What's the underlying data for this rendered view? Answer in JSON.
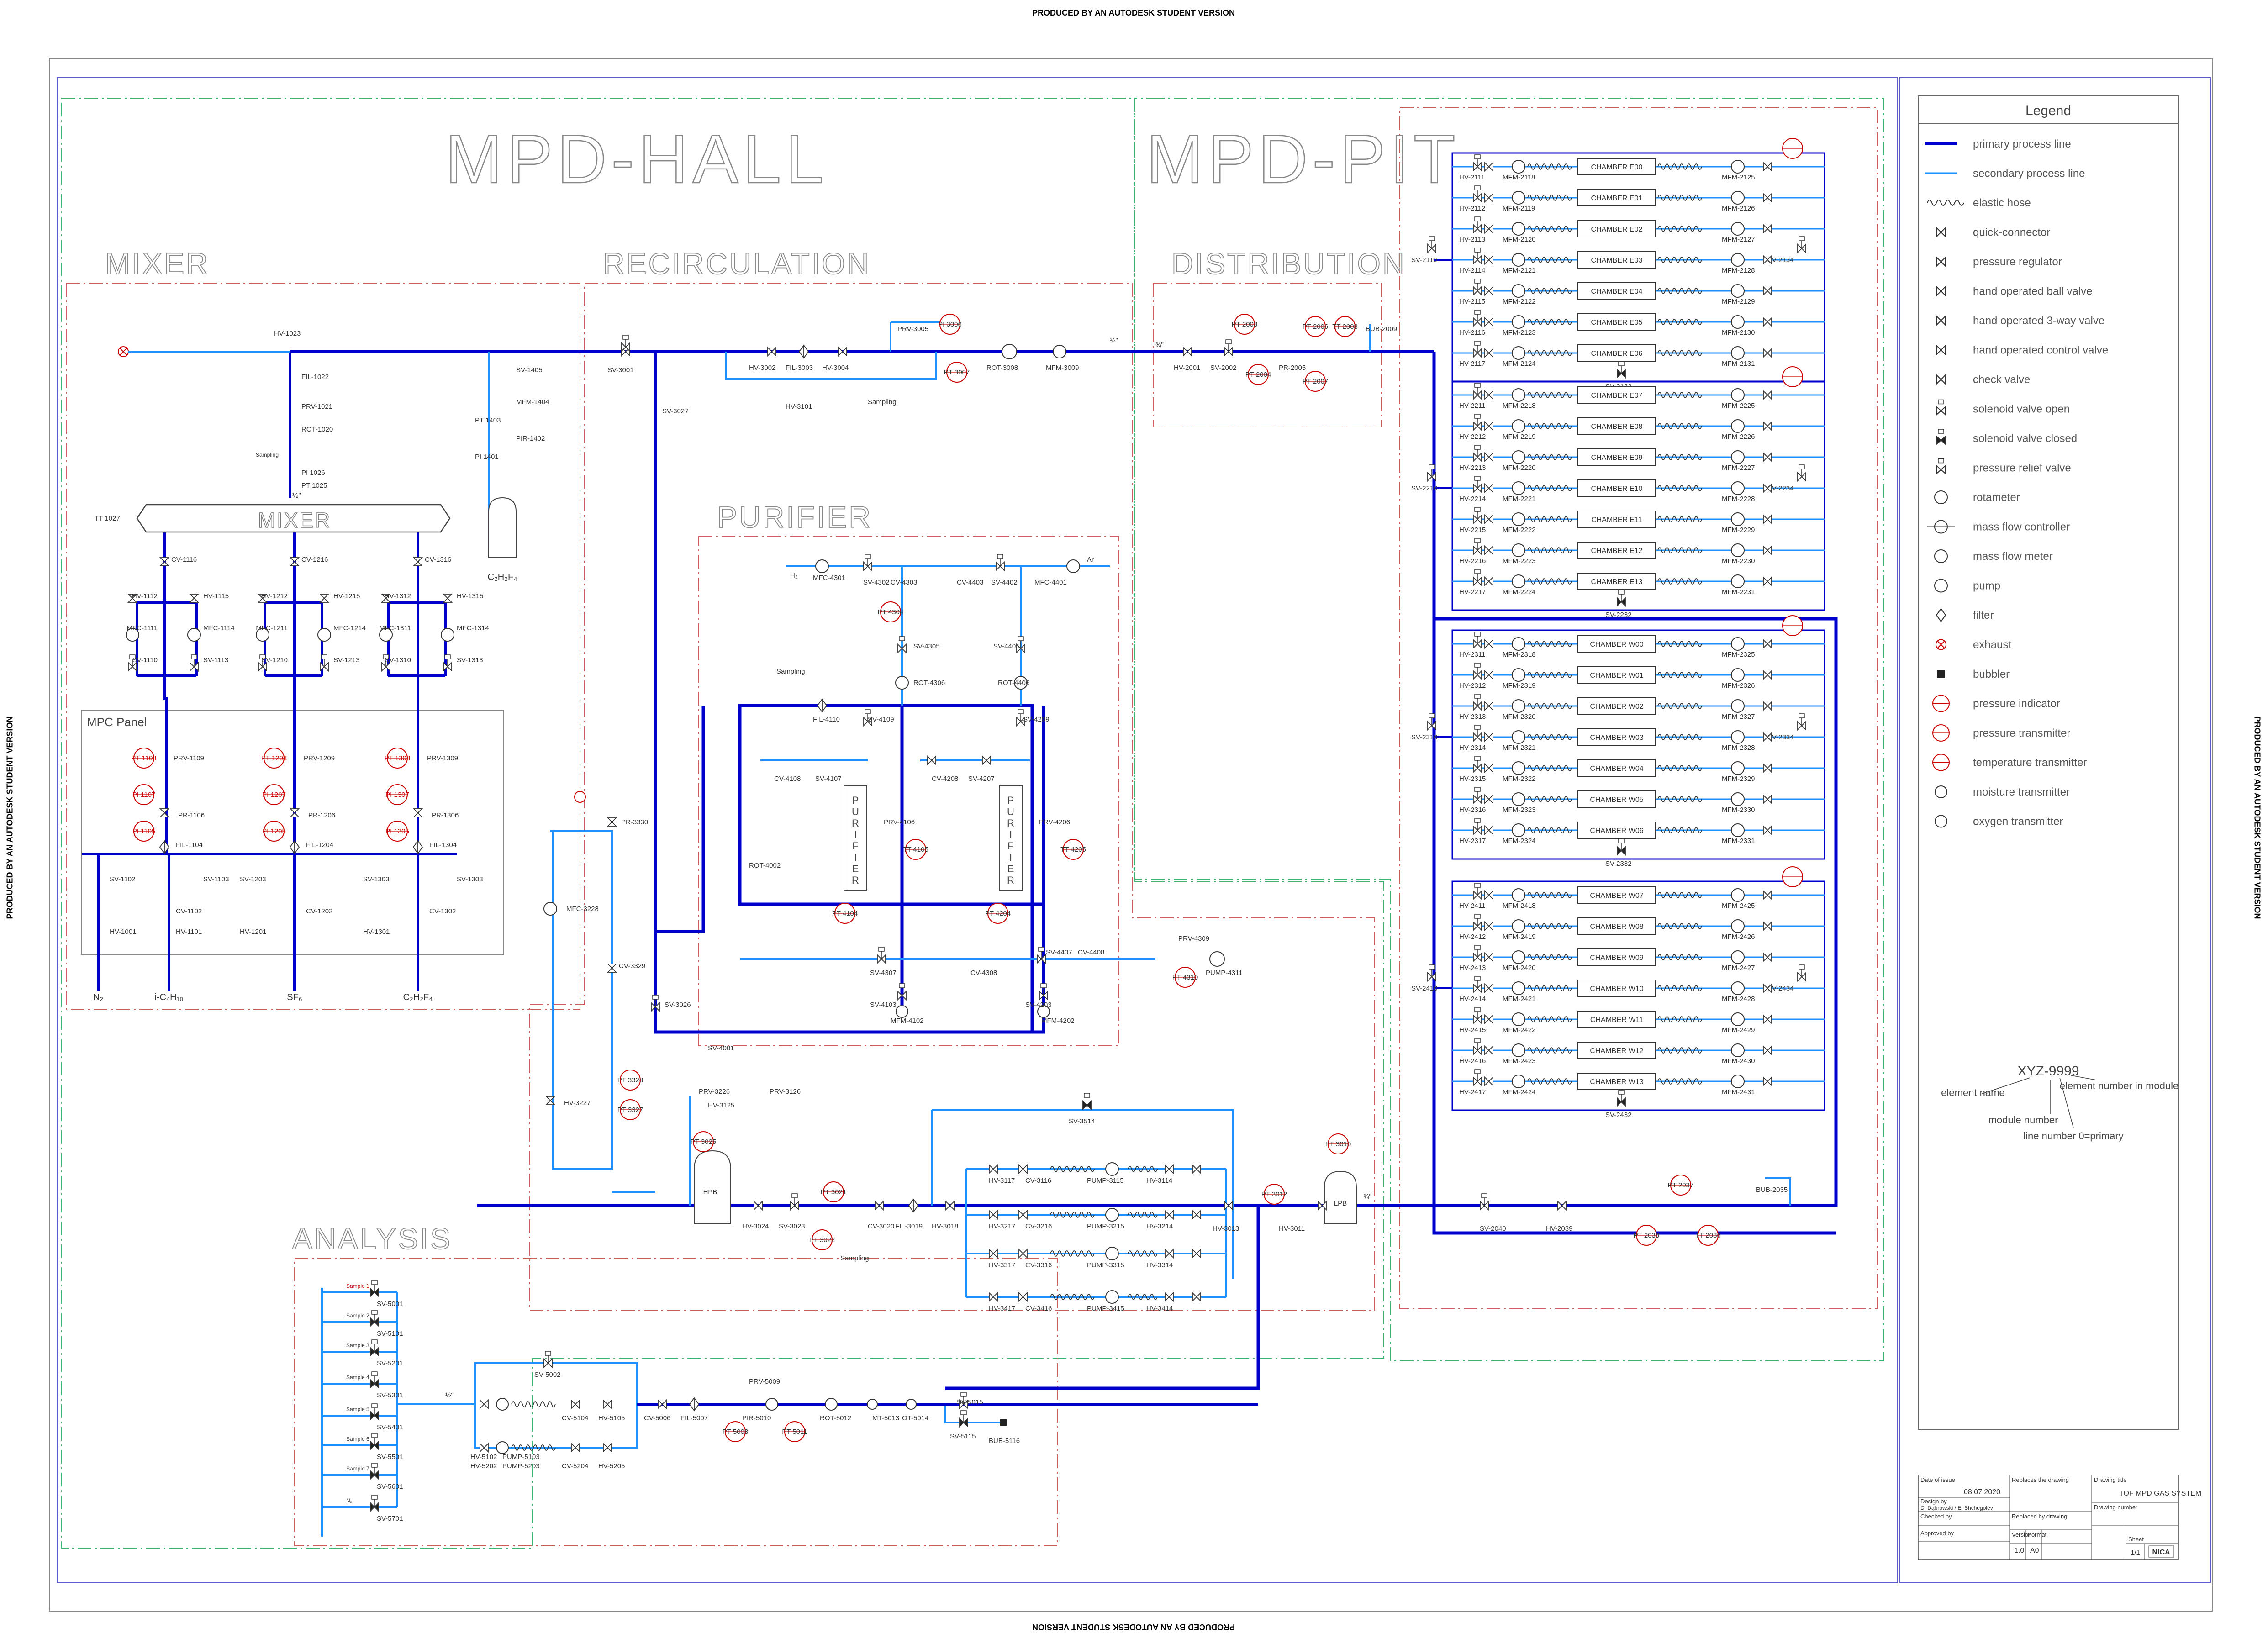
{
  "banner": "PRODUCED BY AN AUTODESK STUDENT VERSION",
  "areas": {
    "hall": "MPD-HALL",
    "pit": "MPD-PIT"
  },
  "sections": {
    "mixer": "MIXER",
    "recirculation": "RECIRCULATION",
    "distribution": "DISTRIBUTION",
    "purifier": "PURIFIER",
    "analysis": "ANALYSIS",
    "mpc_panel": "MPC Panel"
  },
  "mixer": {
    "vessel_label": "MIXER",
    "top_labels": [
      "HV-1023",
      "FIL-1022",
      "PRV-1021",
      "ROT-1020",
      "PI 1026",
      "PT 1025",
      "TT 1027",
      "SV-1405",
      "MFM-1404",
      "PIR-1402",
      "PT 1403",
      "PI 1401"
    ],
    "channels": [
      {
        "cv": "CV-1116",
        "hv_a": "HV-1112",
        "hv_b": "HV-1115",
        "mfc_a": "MFC-1111",
        "mfc_b": "MFC-1114",
        "sv_a": "SV-1110",
        "sv_b": "SV-1113",
        "prv": "PRV-1109",
        "pt": "PT 1108",
        "pi": "PI 1107",
        "pr": "PR-1106",
        "pi2": "PI 1105",
        "fil": "FIL-1104",
        "sv_low_a": "SV-1102",
        "sv_low_b": "SV-1103",
        "cv_low": "CV-1102",
        "hv_low_a": "HV-1001",
        "hv_low_b": "HV-1101"
      },
      {
        "cv": "CV-1216",
        "hv_a": "HV-1212",
        "hv_b": "HV-1215",
        "mfc_a": "MFC-1211",
        "mfc_b": "MFC-1214",
        "sv_a": "SV-1210",
        "sv_b": "SV-1213",
        "prv": "PRV-1209",
        "pt": "PT 1208",
        "pi": "PI 1207",
        "pr": "PR-1206",
        "pi2": "PI 1205",
        "fil": "FIL-1204",
        "sv_low_a": "SV-1203",
        "sv_low_b": "",
        "cv_low": "CV-1202",
        "hv_low_a": "HV-1201",
        "hv_low_b": ""
      },
      {
        "cv": "CV-1316",
        "hv_a": "HV-1312",
        "hv_b": "HV-1315",
        "mfc_a": "MFC-1311",
        "mfc_b": "MFC-1314",
        "sv_a": "SV-1310",
        "sv_b": "SV-1313",
        "prv": "PRV-1309",
        "pt": "PT 1308",
        "pi": "PI 1307",
        "pr": "PR-1306",
        "pi2": "PI 1305",
        "fil": "FIL-1304",
        "sv_low_a": "SV-1303",
        "sv_low_b": "SV-1303",
        "cv_low": "CV-1302",
        "hv_low_a": "HV-1301",
        "hv_low_b": ""
      }
    ],
    "sampling": "Sampling",
    "quarter": "¼\"",
    "half": "½\"",
    "gases": [
      "N₂",
      "i-C₄H₁₀",
      "SF₆",
      "C₂H₂F₄"
    ],
    "bottle": "C₂H₂F₄"
  },
  "recirculation": {
    "labels": [
      "SV-3001",
      "SV-3027",
      "HV-3002",
      "FIL-3003",
      "HV-3004",
      "HV-3101",
      "PRV-3005",
      "PI 3006",
      "PT 3007",
      "ROT-3008",
      "MFM-3009",
      "Sampling",
      "¾\""
    ]
  },
  "distribution_labels": [
    "HV-2001",
    "SV-2002",
    "PT 2003",
    "PT 2004",
    "PR-2005",
    "PT 2006",
    "TT 2008",
    "PT 2007",
    "BUB-2009",
    "¾\""
  ],
  "chamber_groups": [
    {
      "rows": [
        {
          "chamber": "CHAMBER E00",
          "hv": "HV-2111",
          "mfm_in": "MFM-2118",
          "mfm_out": "MFM-2125"
        },
        {
          "chamber": "CHAMBER E01",
          "hv": "HV-2112",
          "mfm_in": "MFM-2119",
          "mfm_out": "MFM-2126"
        },
        {
          "chamber": "CHAMBER E02",
          "hv": "HV-2113",
          "mfm_in": "MFM-2120",
          "mfm_out": "MFM-2127"
        },
        {
          "chamber": "CHAMBER E03",
          "hv": "HV-2114",
          "mfm_in": "MFM-2121",
          "mfm_out": "MFM-2128"
        },
        {
          "chamber": "CHAMBER E04",
          "hv": "HV-2115",
          "mfm_in": "MFM-2122",
          "mfm_out": "MFM-2129"
        },
        {
          "chamber": "CHAMBER E05",
          "hv": "HV-2116",
          "mfm_in": "MFM-2123",
          "mfm_out": "MFM-2130"
        },
        {
          "chamber": "CHAMBER E06",
          "hv": "HV-2117",
          "mfm_in": "MFM-2124",
          "mfm_out": "MFM-2131"
        }
      ],
      "sv_in": "SV-2110",
      "sv_out": "SV-2134",
      "sv_bottom": "SV-2132",
      "pt": "PT 2133"
    },
    {
      "rows": [
        {
          "chamber": "CHAMBER E07",
          "hv": "HV-2211",
          "mfm_in": "MFM-2218",
          "mfm_out": "MFM-2225"
        },
        {
          "chamber": "CHAMBER E08",
          "hv": "HV-2212",
          "mfm_in": "MFM-2219",
          "mfm_out": "MFM-2226"
        },
        {
          "chamber": "CHAMBER E09",
          "hv": "HV-2213",
          "mfm_in": "MFM-2220",
          "mfm_out": "MFM-2227"
        },
        {
          "chamber": "CHAMBER E10",
          "hv": "HV-2214",
          "mfm_in": "MFM-2221",
          "mfm_out": "MFM-2228"
        },
        {
          "chamber": "CHAMBER E11",
          "hv": "HV-2215",
          "mfm_in": "MFM-2222",
          "mfm_out": "MFM-2229"
        },
        {
          "chamber": "CHAMBER E12",
          "hv": "HV-2216",
          "mfm_in": "MFM-2223",
          "mfm_out": "MFM-2230"
        },
        {
          "chamber": "CHAMBER E13",
          "hv": "HV-2217",
          "mfm_in": "MFM-2224",
          "mfm_out": "MFM-2231"
        }
      ],
      "sv_in": "SV-2210",
      "sv_out": "SV-2234",
      "sv_bottom": "SV-2232",
      "pt": "PT 2233"
    },
    {
      "rows": [
        {
          "chamber": "CHAMBER W00",
          "hv": "HV-2311",
          "mfm_in": "MFM-2318",
          "mfm_out": "MFM-2325"
        },
        {
          "chamber": "CHAMBER W01",
          "hv": "HV-2312",
          "mfm_in": "MFM-2319",
          "mfm_out": "MFM-2326"
        },
        {
          "chamber": "CHAMBER W02",
          "hv": "HV-2313",
          "mfm_in": "MFM-2320",
          "mfm_out": "MFM-2327"
        },
        {
          "chamber": "CHAMBER W03",
          "hv": "HV-2314",
          "mfm_in": "MFM-2321",
          "mfm_out": "MFM-2328"
        },
        {
          "chamber": "CHAMBER W04",
          "hv": "HV-2315",
          "mfm_in": "MFM-2322",
          "mfm_out": "MFM-2329"
        },
        {
          "chamber": "CHAMBER W05",
          "hv": "HV-2316",
          "mfm_in": "MFM-2323",
          "mfm_out": "MFM-2330"
        },
        {
          "chamber": "CHAMBER W06",
          "hv": "HV-2317",
          "mfm_in": "MFM-2324",
          "mfm_out": "MFM-2331"
        }
      ],
      "sv_in": "SV-2310",
      "sv_out": "SV-2334",
      "sv_bottom": "SV-2332",
      "pt": "PT 2333"
    },
    {
      "rows": [
        {
          "chamber": "CHAMBER W07",
          "hv": "HV-2411",
          "mfm_in": "MFM-2418",
          "mfm_out": "MFM-2425"
        },
        {
          "chamber": "CHAMBER W08",
          "hv": "HV-2412",
          "mfm_in": "MFM-2419",
          "mfm_out": "MFM-2426"
        },
        {
          "chamber": "CHAMBER W09",
          "hv": "HV-2413",
          "mfm_in": "MFM-2420",
          "mfm_out": "MFM-2427"
        },
        {
          "chamber": "CHAMBER W10",
          "hv": "HV-2414",
          "mfm_in": "MFM-2421",
          "mfm_out": "MFM-2428"
        },
        {
          "chamber": "CHAMBER W11",
          "hv": "HV-2415",
          "mfm_in": "MFM-2422",
          "mfm_out": "MFM-2429"
        },
        {
          "chamber": "CHAMBER W12",
          "hv": "HV-2416",
          "mfm_in": "MFM-2423",
          "mfm_out": "MFM-2430"
        },
        {
          "chamber": "CHAMBER W13",
          "hv": "HV-2417",
          "mfm_in": "MFM-2424",
          "mfm_out": "MFM-2431"
        }
      ],
      "sv_in": "SV-2410",
      "sv_out": "SV-2434",
      "sv_bottom": "SV-2432",
      "pt": "PT 2433"
    }
  ],
  "purifier": {
    "top_labels": [
      "H₂",
      "MFC-4301",
      "SV-4302",
      "CV-4303",
      "CV-4403",
      "SV-4402",
      "MFC-4401",
      "Ar",
      "SV-4305",
      "SV-4405",
      "PT 4304",
      "ROT-4306",
      "ROT-4406",
      "Sampling",
      "FIL-4110",
      "SV-4109",
      "SV-4209",
      "CV-4108",
      "SV-4107",
      "CV-4208",
      "SV-4207",
      "PRV-4106",
      "PRV-4206",
      "TT 4105",
      "TT 4205",
      "ROT-4002",
      "PT 4104",
      "PT 4204",
      "SV-4307",
      "CV-4308",
      "SV-4407",
      "CV-4408",
      "PRV-4309",
      "PT 4310",
      "PUMP-4311",
      "SV-4103",
      "SV-4203",
      "MFM-4102",
      "MFM-4202",
      "SV-4001"
    ],
    "unit_letters": "PURIFIER"
  },
  "recycle_labels": [
    "PR-3330",
    "MFC-3228",
    "CV-3329",
    "HV-3227",
    "PT 3328",
    "PT 3327",
    "SV-3026"
  ],
  "pump_labels": [
    "PRV-3226",
    "PRV-3126",
    "HV-3125",
    "PT 3025",
    "HPB",
    "HV-3024",
    "SV-3023",
    "PT 3021",
    "PT 3022",
    "CV-3020",
    "FIL-3019",
    "HV-3018",
    "Sampling",
    "SV-3514",
    "HV-3117",
    "CV-3116",
    "PUMP-3115",
    "HV-3114",
    "HV-3217",
    "CV-3216",
    "PUMP-3215",
    "HV-3214",
    "HV-3317",
    "CV-3316",
    "PUMP-3315",
    "HV-3314",
    "HV-3417",
    "CV-3416",
    "PUMP-3415",
    "HV-3414",
    "HV-3013",
    "PT 3012",
    "HV-3011",
    "PT 3010",
    "LPB",
    "SV-2040",
    "HV-2039",
    "PT 2038",
    "PT 2037",
    "TT 2036",
    "BUB-2035",
    "¾\""
  ],
  "analysis": {
    "samples": [
      {
        "name": "Sample 1",
        "sv": "SV-5001"
      },
      {
        "name": "Sample 2",
        "sv": "SV-5101"
      },
      {
        "name": "Sample 3",
        "sv": "SV-5201"
      },
      {
        "name": "Sample 4",
        "sv": "SV-5301"
      },
      {
        "name": "Sample 5",
        "sv": "SV-5401"
      },
      {
        "name": "Sample 6",
        "sv": "SV-5501"
      },
      {
        "name": "Sample 7",
        "sv": "SV-5601"
      },
      {
        "name": "N₂",
        "sv": "SV-5701"
      }
    ],
    "labels": [
      "SV-5002",
      "HV-5102",
      "PUMP-5103",
      "CV-5104",
      "HV-5105",
      "HV-5202",
      "PUMP-5203",
      "CV-5204",
      "HV-5205",
      "CV-5006",
      "FIL-5007",
      "PRV-5009",
      "PIR-5010",
      "PT 5008",
      "PT 5011",
      "ROT-5012",
      "MT-5013",
      "OT-5014",
      "SV-5015",
      "SV-5115",
      "BUB-5116",
      "½\""
    ]
  },
  "legend": {
    "title": "Legend",
    "items": [
      {
        "icon": "primary-line",
        "label": "primary process line"
      },
      {
        "icon": "secondary-line",
        "label": "secondary process line"
      },
      {
        "icon": "elastic-hose",
        "label": "elastic hose"
      },
      {
        "icon": "quick-connector",
        "label": "quick-connector"
      },
      {
        "icon": "pressure-regulator",
        "label": "pressure regulator"
      },
      {
        "icon": "ball-valve",
        "label": "hand operated ball valve"
      },
      {
        "icon": "three-way-valve",
        "label": "hand operated 3-way valve"
      },
      {
        "icon": "control-valve",
        "label": "hand operated control valve"
      },
      {
        "icon": "check-valve",
        "label": "check valve"
      },
      {
        "icon": "solenoid-open",
        "label": "solenoid valve open"
      },
      {
        "icon": "solenoid-closed",
        "label": "solenoid valve closed"
      },
      {
        "icon": "relief-valve",
        "label": "pressure relief valve"
      },
      {
        "icon": "rotameter",
        "label": "rotameter"
      },
      {
        "icon": "mass-flow-controller",
        "label": "mass flow controller"
      },
      {
        "icon": "mass-flow-meter",
        "label": "mass flow meter"
      },
      {
        "icon": "pump",
        "label": "pump"
      },
      {
        "icon": "filter",
        "label": "filter"
      },
      {
        "icon": "exhaust",
        "label": "exhaust"
      },
      {
        "icon": "bubbler",
        "label": "bubbler"
      },
      {
        "icon": "pressure-indicator",
        "label": "pressure indicator"
      },
      {
        "icon": "pressure-transmitter",
        "label": "pressure transmitter"
      },
      {
        "icon": "temperature-transmitter",
        "label": "temperature transmitter"
      },
      {
        "icon": "moisture-transmitter",
        "label": "moisture transmitter"
      },
      {
        "icon": "oxygen-transmitter",
        "label": "oxygen transmitter"
      }
    ],
    "explain": {
      "code": "XYZ-9999",
      "element_name": "element name",
      "module_number": "module number",
      "line_number": "line number 0=primary",
      "element_in_module": "element number in module"
    },
    "colors": {
      "primary": "#0000cc",
      "secondary": "#1e90ff",
      "instrument": "#cc0000"
    }
  },
  "title_block": {
    "date_label": "Date of issue",
    "date": "08.07.2020",
    "design_label": "Design by",
    "designers": "D. Dąbrowski / E. Shchegolev",
    "checked_label": "Checked by",
    "approved_label": "Approved by",
    "replaces_label": "Replaces the drawing",
    "replaced_label": "Replaced by drawing",
    "drawing_title_label": "Drawing title",
    "drawing_title": "TOF MPD GAS SYSTEM",
    "drawing_number_label": "Drawing number",
    "version_label": "Version",
    "version": "1.0",
    "format_label": "Format",
    "format": "A0",
    "sheet_label": "Sheet",
    "sheet": "1/1",
    "logo": "NICA"
  }
}
